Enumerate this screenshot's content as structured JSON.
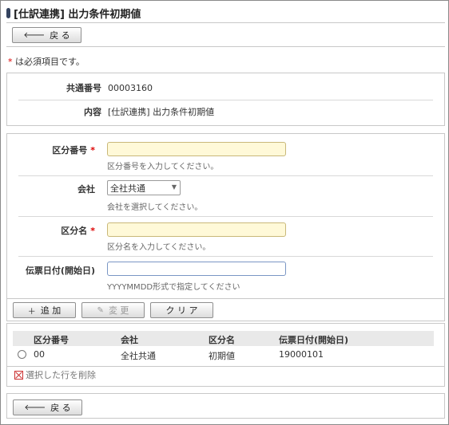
{
  "header": {
    "title": "[仕訳連携] 出力条件初期値"
  },
  "nav": {
    "back_label": "戻 る",
    "back_icon": "arrow-left-icon"
  },
  "required_note": {
    "star": "*",
    "text": "は必須項目です。"
  },
  "info": {
    "common_number_label": "共通番号",
    "common_number_value": "00003160",
    "content_label": "内容",
    "content_value": "[仕訳連携] 出力条件初期値"
  },
  "form": {
    "division_number": {
      "label": "区分番号",
      "star": "*",
      "value": "",
      "help": "区分番号を入力してください。"
    },
    "company": {
      "label": "会社",
      "selected": "全社共通",
      "help": "会社を選択してください。"
    },
    "division_name": {
      "label": "区分名",
      "star": "*",
      "value": "",
      "help": "区分名を入力してください。"
    },
    "slip_date": {
      "label": "伝票日付(開始日)",
      "value": "",
      "help": "YYYYMMDD形式で指定してください"
    }
  },
  "actions": {
    "add_label": "追 加",
    "change_label": "変 更",
    "clear_label": "ク リ ア"
  },
  "table": {
    "headers": [
      "区分番号",
      "会社",
      "区分名",
      "伝票日付(開始日)"
    ],
    "rows": [
      {
        "division_number": "00",
        "company": "全社共通",
        "division_name": "初期値",
        "slip_date": "19000101"
      }
    ],
    "delete_label": "選択した行を削除"
  },
  "colors": {
    "required": "#d00000",
    "title_mark": "#34435f",
    "required_input_bg": "#fff9d8"
  }
}
